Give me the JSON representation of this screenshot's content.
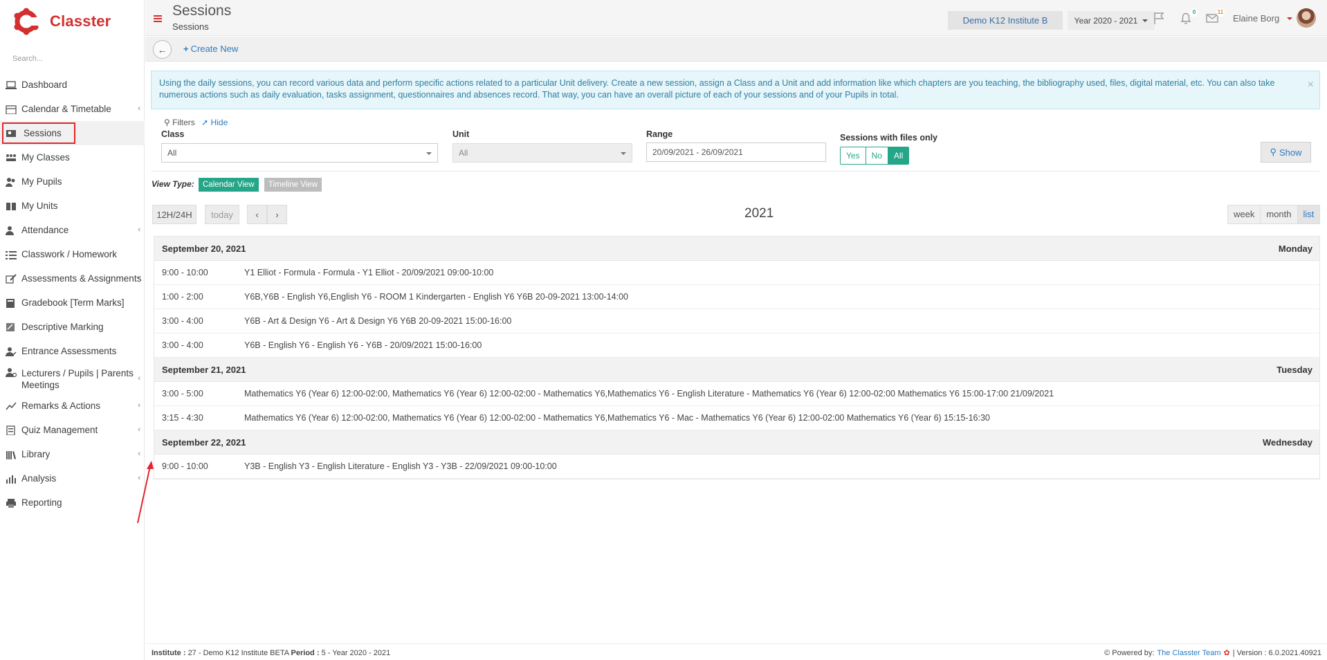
{
  "app": {
    "name": "Classter",
    "search_placeholder": "Search..."
  },
  "sidebar": {
    "items": [
      {
        "label": "Dashboard",
        "icon": "laptop-icon",
        "has_children": false,
        "active": false
      },
      {
        "label": "Calendar & Timetable",
        "icon": "calendar-icon",
        "has_children": true,
        "active": false
      },
      {
        "label": "Sessions",
        "icon": "sessions-icon",
        "has_children": false,
        "active": true
      },
      {
        "label": "My Classes",
        "icon": "classes-icon",
        "has_children": false,
        "active": false
      },
      {
        "label": "My Pupils",
        "icon": "pupils-icon",
        "has_children": false,
        "active": false
      },
      {
        "label": "My Units",
        "icon": "book-icon",
        "has_children": false,
        "active": false
      },
      {
        "label": "Attendance",
        "icon": "attendance-icon",
        "has_children": true,
        "active": false
      },
      {
        "label": "Classwork / Homework",
        "icon": "list-icon",
        "has_children": false,
        "active": false
      },
      {
        "label": "Assessments & Assignments",
        "icon": "edit-icon",
        "has_children": true,
        "active": false
      },
      {
        "label": "Gradebook [Term Marks]",
        "icon": "gradebook-icon",
        "has_children": false,
        "active": false
      },
      {
        "label": "Descriptive Marking",
        "icon": "marking-icon",
        "has_children": false,
        "active": false
      },
      {
        "label": "Entrance Assessments",
        "icon": "entrance-icon",
        "has_children": false,
        "active": false
      },
      {
        "label": "Lecturers / Pupils | Parents Meetings",
        "icon": "meetings-icon",
        "has_children": true,
        "active": false
      },
      {
        "label": "Remarks & Actions",
        "icon": "remarks-icon",
        "has_children": true,
        "active": false
      },
      {
        "label": "Quiz Management",
        "icon": "quiz-icon",
        "has_children": true,
        "active": false
      },
      {
        "label": "Library",
        "icon": "library-icon",
        "has_children": true,
        "active": false
      },
      {
        "label": "Analysis",
        "icon": "analysis-icon",
        "has_children": true,
        "active": false
      },
      {
        "label": "Reporting",
        "icon": "printer-icon",
        "has_children": false,
        "active": false
      }
    ]
  },
  "header": {
    "title": "Sessions",
    "subtitle": "Sessions",
    "institute": "Demo K12 Institute B",
    "year": "Year 2020 - 2021",
    "notifications_count": "0",
    "messages_count": "11",
    "user_name": "Elaine Borg"
  },
  "actions": {
    "create_new": "Create New"
  },
  "info": {
    "text": "Using the daily sessions, you can record various data and perform specific actions related to a particular Unit delivery. Create a new session, assign a Class and a Unit and add information like which chapters are you teaching, the bibliography used, files, digital material, etc. You can also take numerous actions such as daily evaluation, tasks assignment, questionnaires and absences record. That way, you can have an overall picture of each of your sessions and of your Pupils in total."
  },
  "filters": {
    "title": "Filters",
    "hide": "Hide",
    "class_label": "Class",
    "class_value": "All",
    "unit_label": "Unit",
    "unit_value": "All",
    "range_label": "Range",
    "range_value": "20/09/2021 - 26/09/2021",
    "files_label": "Sessions with files only",
    "files_options": [
      "Yes",
      "No",
      "All"
    ],
    "files_selected": "All",
    "show": "Show"
  },
  "view_type": {
    "label": "View Type:",
    "calendar": "Calendar View",
    "timeline": "Timeline View"
  },
  "calendar": {
    "btn_12_24": "12H/24H",
    "btn_today": "today",
    "title": "2021",
    "views": [
      "week",
      "month",
      "list"
    ],
    "active_view": "list",
    "days": [
      {
        "date": "September 20, 2021",
        "weekday": "Monday",
        "events": [
          {
            "time": "9:00 - 10:00",
            "title": "Y1 Elliot - Formula - Formula - Y1 Elliot - 20/09/2021 09:00-10:00"
          },
          {
            "time": "1:00 - 2:00",
            "title": "Y6B,Y6B - English Y6,English Y6 - ROOM 1 Kindergarten - English Y6 Y6B 20-09-2021 13:00-14:00"
          },
          {
            "time": "3:00 - 4:00",
            "title": "Y6B - Art & Design Y6 - Art & Design Y6 Y6B 20-09-2021 15:00-16:00"
          },
          {
            "time": "3:00 - 4:00",
            "title": "Y6B - English Y6 - English Y6 - Y6B - 20/09/2021 15:00-16:00"
          }
        ]
      },
      {
        "date": "September 21, 2021",
        "weekday": "Tuesday",
        "events": [
          {
            "time": "3:00 - 5:00",
            "title": "Mathematics Y6 (Year 6) 12:00-02:00, Mathematics Y6 (Year 6) 12:00-02:00 - Mathematics Y6,Mathematics Y6 - English Literature - Mathematics Y6 (Year 6) 12:00-02:00 Mathematics Y6 15:00-17:00 21/09/2021"
          },
          {
            "time": "3:15 - 4:30",
            "title": "Mathematics Y6 (Year 6) 12:00-02:00, Mathematics Y6 (Year 6) 12:00-02:00 - Mathematics Y6,Mathematics Y6 - Mac - Mathematics Y6 (Year 6) 12:00-02:00 Mathematics Y6 (Year 6) 15:15-16:30"
          }
        ]
      },
      {
        "date": "September 22, 2021",
        "weekday": "Wednesday",
        "events": [
          {
            "time": "9:00 - 10:00",
            "title": "Y3B - English Y3 - English Literature - English Y3 - Y3B - 22/09/2021 09:00-10:00"
          }
        ]
      }
    ]
  },
  "footer": {
    "institute_label": "Institute :",
    "institute_value": "27 - Demo K12 Institute BETA",
    "period_label": "Period :",
    "period_value": "5 - Year 2020 - 2021",
    "powered_by": "Powered by:",
    "team": "The Classter Team",
    "version": "| Version : 6.0.2021.40921"
  },
  "colors": {
    "brand": "#d32f2f",
    "accent_green": "#26a689",
    "link_blue": "#2b7bbf",
    "annotation_red": "#e3262e"
  }
}
